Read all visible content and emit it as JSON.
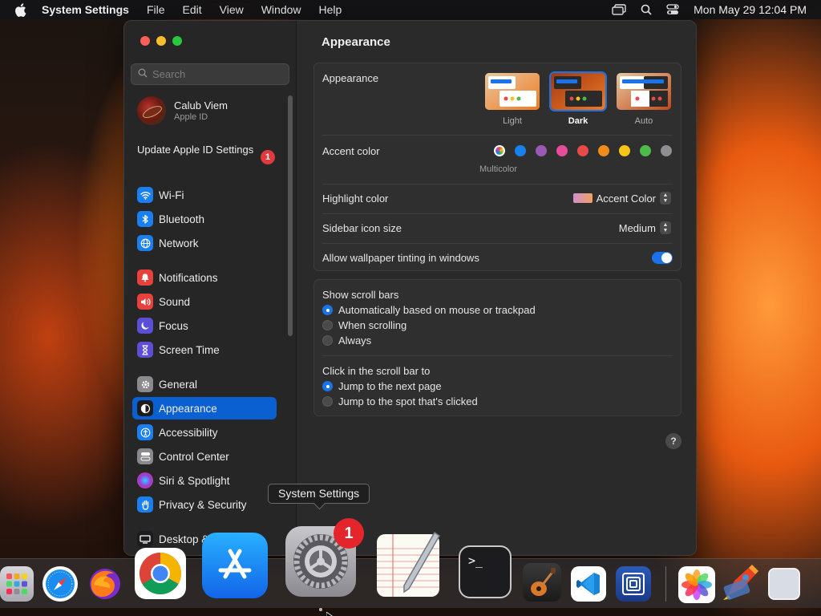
{
  "menubar": {
    "app_name": "System Settings",
    "menus": [
      "File",
      "Edit",
      "View",
      "Window",
      "Help"
    ],
    "clock": "Mon May 29  12:04 PM"
  },
  "sidebar": {
    "search_placeholder": "Search",
    "profile": {
      "name": "Calub Viem",
      "subtitle": "Apple ID"
    },
    "update": {
      "label": "Update Apple ID Settings",
      "badge": "1"
    },
    "items": [
      {
        "label": "Wi-Fi",
        "icon": "wifi-icon",
        "color": "#1a7ff0"
      },
      {
        "label": "Bluetooth",
        "icon": "bluetooth-icon",
        "color": "#1a7ff0"
      },
      {
        "label": "Network",
        "icon": "globe-icon",
        "color": "#1a7ff0"
      },
      {
        "label": "Notifications",
        "icon": "bell-icon",
        "color": "#e8413c"
      },
      {
        "label": "Sound",
        "icon": "speaker-icon",
        "color": "#e8413c"
      },
      {
        "label": "Focus",
        "icon": "moon-icon",
        "color": "#5b4fd6"
      },
      {
        "label": "Screen Time",
        "icon": "hourglass-icon",
        "color": "#5b4fd6"
      },
      {
        "label": "General",
        "icon": "gear-icon",
        "color": "#8a8a8e"
      },
      {
        "label": "Appearance",
        "icon": "appearance-icon",
        "color": "#1c1c1e"
      },
      {
        "label": "Accessibility",
        "icon": "accessibility-icon",
        "color": "#1a7ff0"
      },
      {
        "label": "Control Center",
        "icon": "control-center-icon",
        "color": "#8a8a8e"
      },
      {
        "label": "Siri & Spotlight",
        "icon": "siri-icon",
        "color": "#c0308a"
      },
      {
        "label": "Privacy & Security",
        "icon": "hand-icon",
        "color": "#1a7ff0"
      },
      {
        "label": "Desktop &",
        "icon": "desktop-icon",
        "color": "#1c1c1e"
      }
    ]
  },
  "main": {
    "title": "Appearance",
    "appearance": {
      "label": "Appearance",
      "options": [
        "Light",
        "Dark",
        "Auto"
      ],
      "selected": "Dark"
    },
    "accent": {
      "label": "Accent color",
      "multicolor_label": "Multicolor",
      "colors": [
        "#c64fd0",
        "#1a7ff0",
        "#9b59b6",
        "#e94b9b",
        "#e84a4a",
        "#f08c1a",
        "#f5c518",
        "#4cbb4c",
        "#8e8e93"
      ]
    },
    "highlight": {
      "label": "Highlight color",
      "value": "Accent Color"
    },
    "sidebar_icon": {
      "label": "Sidebar icon size",
      "value": "Medium"
    },
    "tinting": {
      "label": "Allow wallpaper tinting in windows",
      "enabled": true
    },
    "scroll_bars": {
      "label": "Show scroll bars",
      "options": [
        "Automatically based on mouse or trackpad",
        "When scrolling",
        "Always"
      ]
    },
    "click_scroll": {
      "label": "Click in the scroll bar to",
      "options": [
        "Jump to the next page",
        "Jump to the spot that's clicked"
      ]
    },
    "help": "?"
  },
  "tooltip": "System Settings",
  "dock": {
    "badge": "1",
    "terminal_prompt": ">_"
  }
}
